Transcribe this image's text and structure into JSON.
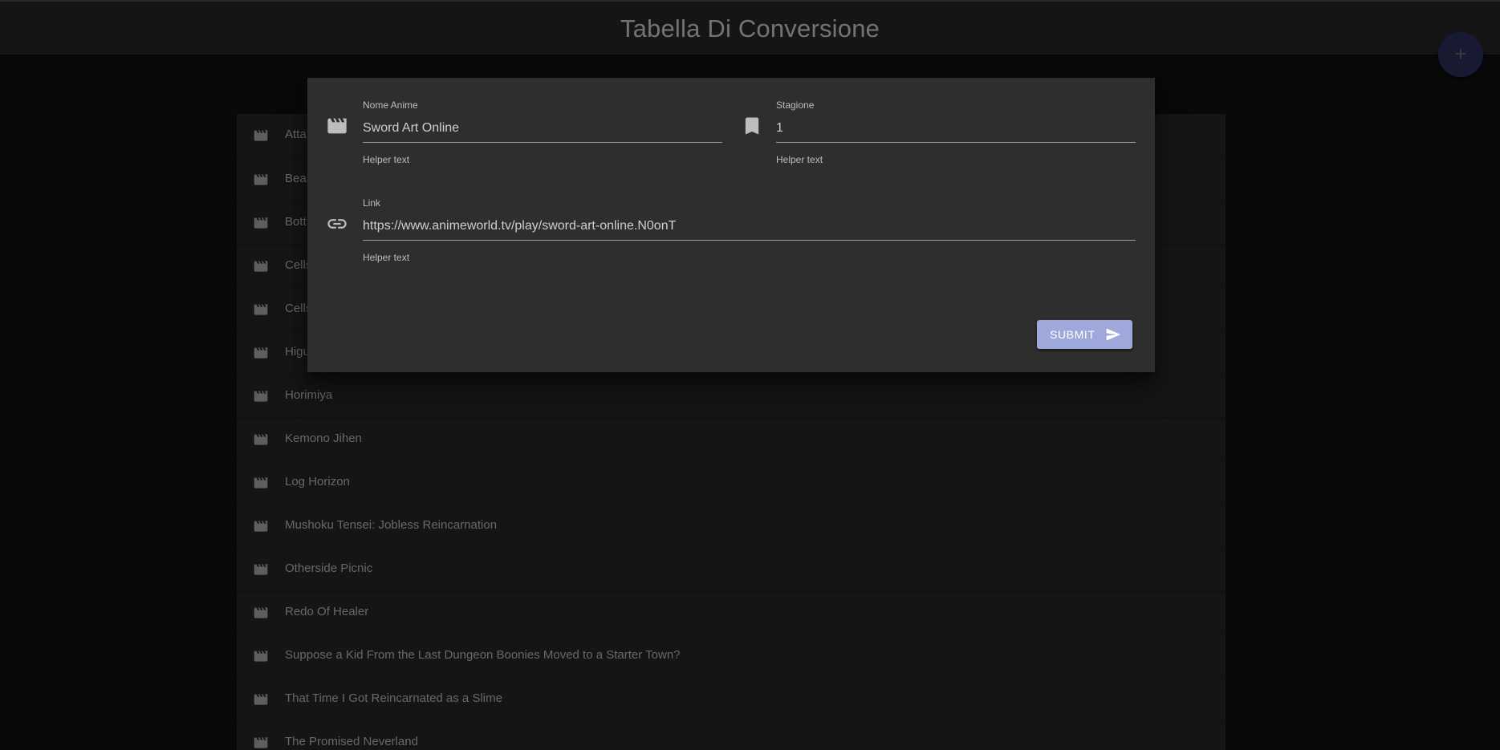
{
  "header": {
    "title": "Tabella Di Conversione"
  },
  "fab": {
    "icon": "plus-icon",
    "label": "+"
  },
  "list": {
    "item_icon": "clapperboard-icon",
    "items": [
      {
        "label": "Atta"
      },
      {
        "label": "Beas"
      },
      {
        "label": "Bott"
      },
      {
        "label": "Cells"
      },
      {
        "label": "Cells"
      },
      {
        "label": "Higu"
      },
      {
        "label": "Horimiya"
      },
      {
        "label": "Kemono Jihen"
      },
      {
        "label": "Log Horizon"
      },
      {
        "label": "Mushoku Tensei: Jobless Reincarnation"
      },
      {
        "label": "Otherside Picnic"
      },
      {
        "label": "Redo Of Healer"
      },
      {
        "label": "Suppose a Kid From the Last Dungeon Boonies Moved to a Starter Town?"
      },
      {
        "label": "That Time I Got Reincarnated as a Slime"
      },
      {
        "label": "The Promised Neverland"
      }
    ]
  },
  "dialog": {
    "name_field": {
      "icon": "clapperboard-icon",
      "label": "Nome Anime",
      "value": "Sword Art Online",
      "helper": "Helper text"
    },
    "season_field": {
      "icon": "bookmark-icon",
      "label": "Stagione",
      "value": "1",
      "helper": "Helper text"
    },
    "link_field": {
      "icon": "link-icon",
      "label": "Link",
      "value": "https://www.animeworld.tv/play/sword-art-online.N0onT",
      "helper": "Helper text"
    },
    "submit": {
      "label": "SUBMIT",
      "icon": "send-icon"
    }
  },
  "colors": {
    "accent": "#9fa8da",
    "fab": "#5c6bc0",
    "dialog_bg": "#2e2e2e",
    "list_bg": "#2a2a2a",
    "topbar_bg": "#2b2b2b"
  }
}
